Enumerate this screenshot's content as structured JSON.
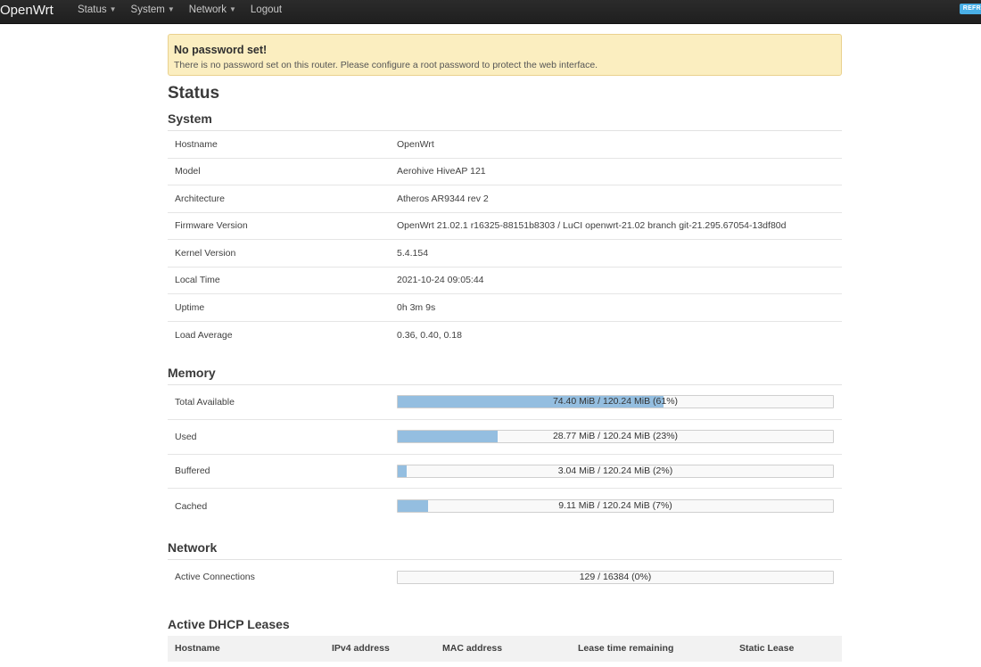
{
  "navbar": {
    "brand": "OpenWrt",
    "menu": [
      {
        "label": "Status",
        "dropdown": true
      },
      {
        "label": "System",
        "dropdown": true
      },
      {
        "label": "Network",
        "dropdown": true
      },
      {
        "label": "Logout",
        "dropdown": false
      }
    ],
    "refresh_badge": "REFR"
  },
  "alert": {
    "title": "No password set!",
    "message": "There is no password set on this router. Please configure a root password to protect the web interface."
  },
  "page_title": "Status",
  "system": {
    "heading": "System",
    "rows": [
      {
        "label": "Hostname",
        "value": "OpenWrt"
      },
      {
        "label": "Model",
        "value": "Aerohive HiveAP 121"
      },
      {
        "label": "Architecture",
        "value": "Atheros AR9344 rev 2"
      },
      {
        "label": "Firmware Version",
        "value": "OpenWrt 21.02.1 r16325-88151b8303 / LuCI openwrt-21.02 branch git-21.295.67054-13df80d"
      },
      {
        "label": "Kernel Version",
        "value": "5.4.154"
      },
      {
        "label": "Local Time",
        "value": "2021-10-24 09:05:44"
      },
      {
        "label": "Uptime",
        "value": "0h 3m 9s"
      },
      {
        "label": "Load Average",
        "value": "0.36, 0.40, 0.18"
      }
    ]
  },
  "memory": {
    "heading": "Memory",
    "rows": [
      {
        "label": "Total Available",
        "text": "74.40 MiB / 120.24 MiB (61%)",
        "percent": 61
      },
      {
        "label": "Used",
        "text": "28.77 MiB / 120.24 MiB (23%)",
        "percent": 23
      },
      {
        "label": "Buffered",
        "text": "3.04 MiB / 120.24 MiB (2%)",
        "percent": 2
      },
      {
        "label": "Cached",
        "text": "9.11 MiB / 120.24 MiB (7%)",
        "percent": 7
      }
    ]
  },
  "network": {
    "heading": "Network",
    "rows": [
      {
        "label": "Active Connections",
        "text": "129 / 16384 (0%)",
        "percent": 0
      }
    ]
  },
  "dhcp": {
    "heading": "Active DHCP Leases",
    "columns": [
      "Hostname",
      "IPv4 address",
      "MAC address",
      "Lease time remaining",
      "Static Lease"
    ]
  },
  "colors": {
    "navbar_bg": "#222222",
    "alert_bg": "#fbeec0",
    "bar_fill": "#94bee0",
    "badge": "#49afe6"
  }
}
